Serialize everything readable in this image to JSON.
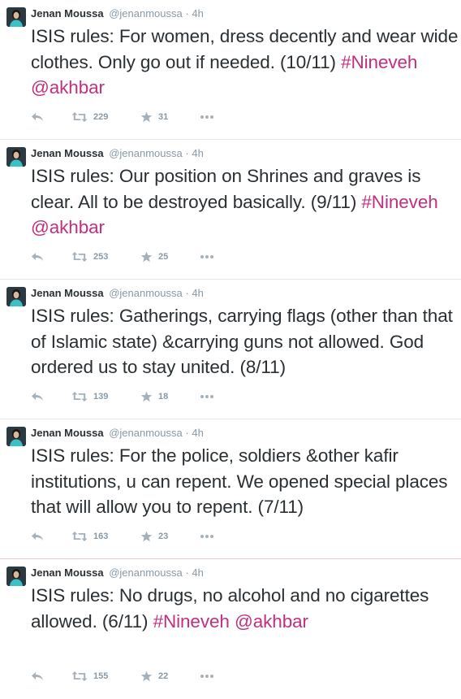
{
  "tweets": [
    {
      "name": "Jenan Moussa",
      "handle": "@jenanmoussa",
      "sep": "·",
      "time": "4h",
      "text_main": "ISIS rules: For women, dress decently and wear wide clothes. Only go out if needed. (10/11) ",
      "hashtag": "#Nineveh",
      "mention": "@akhbar",
      "retweets": "229",
      "favorites": "31"
    },
    {
      "name": "Jenan Moussa",
      "handle": "@jenanmoussa",
      "sep": "·",
      "time": "4h",
      "text_main": "ISIS rules: Our position on Shrines and graves is clear. All to be destroyed basically. (9/11) ",
      "hashtag": "#Nineveh",
      "mention": "@akhbar",
      "retweets": "253",
      "favorites": "25"
    },
    {
      "name": "Jenan Moussa",
      "handle": "@jenanmoussa",
      "sep": "·",
      "time": "4h",
      "text_main": "ISIS rules: Gatherings, carrying flags (other than that of Islamic state) &carrying guns not allowed. God ordered us to stay united. (8/11)",
      "hashtag": "",
      "mention": "",
      "retweets": "139",
      "favorites": "18"
    },
    {
      "name": "Jenan Moussa",
      "handle": "@jenanmoussa",
      "sep": "·",
      "time": "4h",
      "text_main": "ISIS rules: For the police, soldiers &other kafir institutions, u can repent. We opened special places that will allow you to repent. (7/11)",
      "hashtag": "",
      "mention": "",
      "retweets": "163",
      "favorites": "23"
    },
    {
      "name": "Jenan Moussa",
      "handle": "@jenanmoussa",
      "sep": "·",
      "time": "4h",
      "text_main": "ISIS rules: No drugs, no alcohol and no cigarettes allowed. (6/11) ",
      "hashtag": "#Nineveh",
      "mention": "@akhbar",
      "retweets": "155",
      "favorites": "22"
    }
  ],
  "colors": {
    "link": "#c1307e",
    "text": "#292f33",
    "muted": "#8899a6",
    "icon": "#a4b1bb"
  },
  "icons": [
    "reply-icon",
    "retweet-icon",
    "favorite-star-icon",
    "more-options-icon"
  ]
}
